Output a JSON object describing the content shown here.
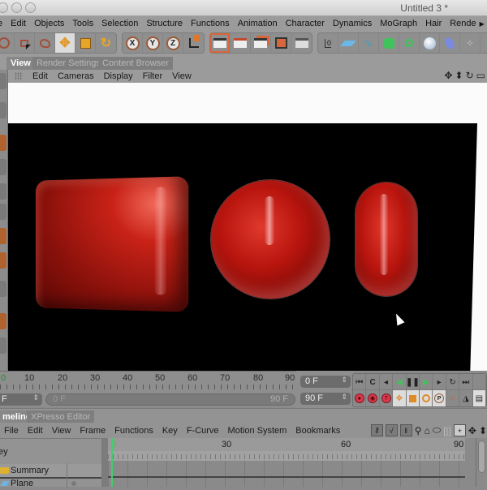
{
  "window": {
    "title": "Untitled 3 *"
  },
  "menubar": {
    "items": [
      "e",
      "Edit",
      "Objects",
      "Tools",
      "Selection",
      "Structure",
      "Functions",
      "Animation",
      "Character",
      "Dynamics",
      "MoGraph",
      "Hair",
      "Rende"
    ]
  },
  "toolbar": {
    "groups": [
      {
        "name": "selection-tools",
        "icons": [
          "live-selection-icon",
          "rectangle-selection-icon",
          "lasso-selection-icon",
          "move-icon",
          "scale-icon",
          "rotate-icon"
        ]
      },
      {
        "name": "axis-lock",
        "icons": [
          "x-axis-icon",
          "y-axis-icon",
          "z-axis-icon",
          "coordinate-system-icon"
        ]
      },
      {
        "name": "render",
        "icons": [
          "render-view-icon",
          "render-picture-viewer-icon",
          "render-region-icon",
          "edit-render-settings-icon",
          "render-queue-icon"
        ]
      },
      {
        "name": "objects",
        "icons": [
          "null-object-icon",
          "plane-icon",
          "spline-icon",
          "subdivision-surface-icon",
          "array-icon",
          "sphere-primitive-icon",
          "deformer-icon",
          "particle-icon",
          "mograph-cloner-icon"
        ]
      },
      {
        "name": "help",
        "icons": [
          "help-icon",
          "calculator-icon"
        ]
      }
    ],
    "axis_labels": [
      "X",
      "Y",
      "Z"
    ]
  },
  "tabs": [
    "View",
    "Render Settings",
    "Content Browser"
  ],
  "active_tab": "View",
  "view_menu": [
    "Edit",
    "Cameras",
    "Display",
    "Filter",
    "View"
  ],
  "viewport": {
    "objects": [
      "cube",
      "sphere",
      "capsule"
    ],
    "render_color": "#c21a12"
  },
  "timeline_ruler": {
    "labels": [
      "0",
      "10",
      "20",
      "30",
      "40",
      "50",
      "60",
      "70",
      "80",
      "90"
    ]
  },
  "frame_controls": {
    "current_frame_left": "F",
    "range_start": "0 F",
    "range_end": "90 F",
    "current_frame": "0 F",
    "end_frame": "90 F"
  },
  "playback": {
    "row1": [
      "go-to-start-icon",
      "previous-key-icon",
      "previous-frame-icon",
      "play-backwards-icon",
      "pause-icon",
      "play-forwards-icon",
      "next-frame-icon",
      "next-key-icon",
      "go-to-end-icon"
    ],
    "row2": [
      "record-active-icon",
      "autokey-icon",
      "keyframe-selection-icon",
      "record-position-icon",
      "record-scale-icon",
      "record-rotation-icon",
      "record-parameter-icon",
      "record-pla-icon",
      "scheme-icon",
      "timeline-icon"
    ],
    "accent_green": "#3ec45a",
    "accent_red": "#d8384a"
  },
  "bottom_tabs": [
    "meline",
    "XPresso Editor"
  ],
  "bottom_active_tab": "meline",
  "timeline_menu": [
    "File",
    "Edit",
    "View",
    "Frame",
    "Functions",
    "Key",
    "F-Curve",
    "Motion System",
    "Bookmarks"
  ],
  "timeline_tools": [
    "key-mode-icon",
    "f-curve-mode-icon",
    "motion-clip-icon",
    "zoom-icon",
    "home-icon",
    "link-icon",
    "bracket-icon",
    "add-marker-icon",
    "pan-icon",
    "dolly-icon"
  ],
  "tree": {
    "header": "ey",
    "rows": [
      {
        "label": "Summary",
        "icon": "folder-icon"
      },
      {
        "label": "Plane",
        "icon": "plane-icon"
      }
    ]
  },
  "keyframe_ruler": {
    "labels": [
      "0",
      "30",
      "60",
      "90"
    ]
  }
}
